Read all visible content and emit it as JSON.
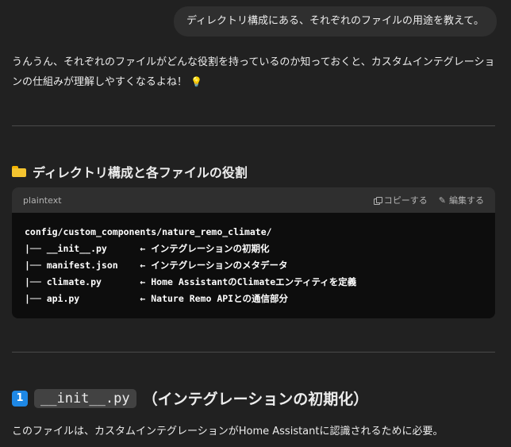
{
  "user_message": "ディレクトリ構成にある、それぞれのファイルの用途を教えて。",
  "intro": {
    "text": "うんうん、それぞれのファイルがどんな役割を持っているのか知っておくと、カスタムインテグレーションの仕組みが理解しやすくなるよね！",
    "emoji": "💡"
  },
  "section1": {
    "icon": "folder-icon",
    "title": "ディレクトリ構成と各ファイルの役割"
  },
  "codeblock": {
    "language": "plaintext",
    "copy_label": "コピーする",
    "edit_label": "編集する",
    "lines": [
      "config/custom_components/nature_remo_climate/",
      "|── __init__.py      ← インテグレーションの初期化",
      "|── manifest.json    ← インテグレーションのメタデータ",
      "|── climate.py       ← Home AssistantのClimateエンティティを定義",
      "|── api.py           ← Nature Remo APIとの通信部分"
    ]
  },
  "section2": {
    "number": "1",
    "code": "__init__.py",
    "title": "（インテグレーションの初期化）"
  },
  "para2": "このファイルは、カスタムインテグレーションがHome Assistantに認識されるために必要。"
}
